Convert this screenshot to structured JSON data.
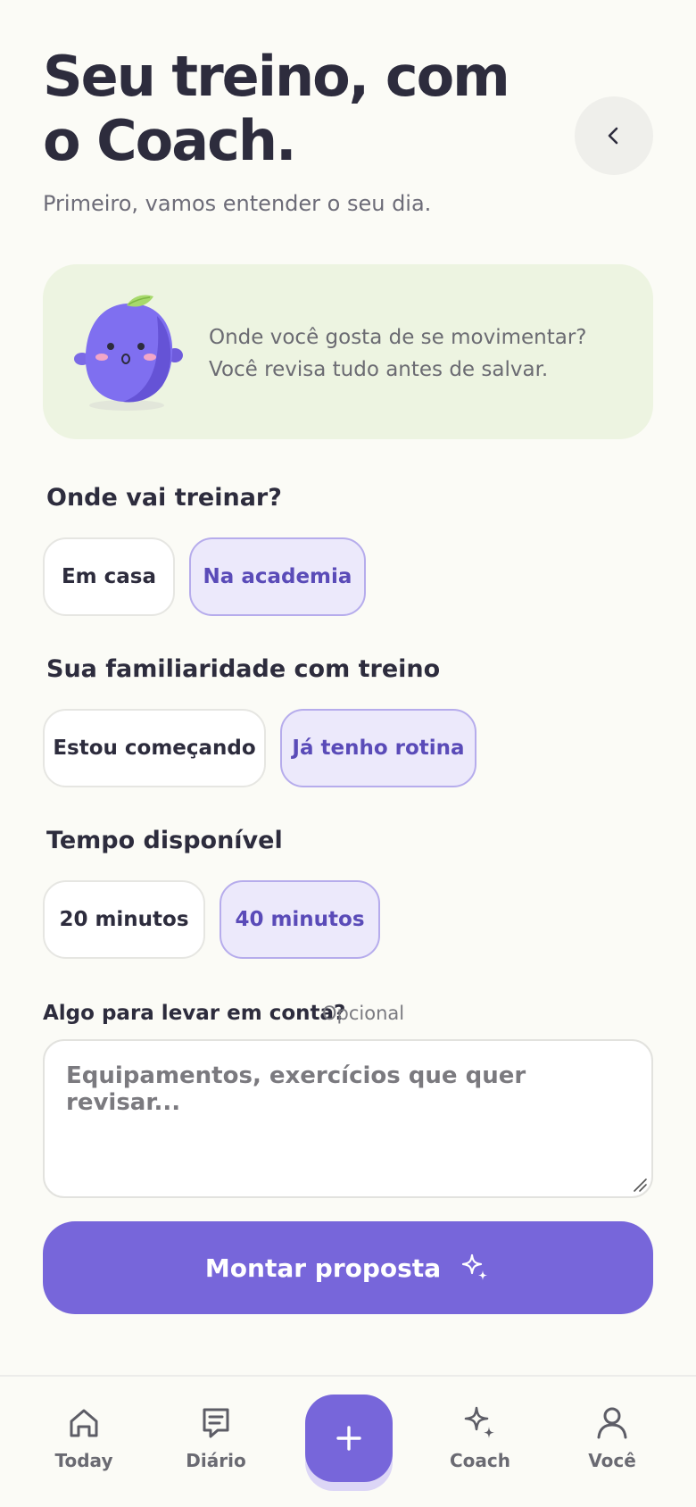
{
  "header": {
    "title": "Seu treino, com o Coach.",
    "subtitle": "Primeiro, vamos entender o seu dia.",
    "back_icon": "chevron-left-icon"
  },
  "coach_card": {
    "line1": "Onde você gosta de se movimentar?",
    "line2": "Você revisa tudo antes de salvar.",
    "mascot": "plum-mascot"
  },
  "where": {
    "label": "Onde vai treinar?",
    "options": [
      "Em casa",
      "Na academia"
    ],
    "selected": "Na academia"
  },
  "familiarity": {
    "label": "Sua familiaridade com treino",
    "options": [
      "Estou começando",
      "Já tenho rotina"
    ],
    "selected": "Já tenho rotina"
  },
  "time": {
    "label": "Tempo disponível",
    "options": [
      "20 minutos",
      "40 minutos"
    ],
    "selected": "40 minutos"
  },
  "notes": {
    "label": "Algo para levar em conta?",
    "optional": "Opcional",
    "placeholder": "Equipamentos, exercícios que quer revisar...",
    "value": ""
  },
  "cta": {
    "label": "Montar proposta",
    "icon": "sparkles-icon"
  },
  "tabbar": {
    "items": [
      {
        "label": "Today",
        "icon": "home-icon"
      },
      {
        "label": "Diário",
        "icon": "journal-icon"
      },
      {
        "label": "",
        "icon": "plus-icon"
      },
      {
        "label": "Coach",
        "icon": "sparkles-icon"
      },
      {
        "label": "Você",
        "icon": "user-icon"
      }
    ]
  },
  "colors": {
    "accent": "#7766da",
    "selected_chip_bg": "#ece9fb",
    "selected_chip_border": "#b6acec",
    "card_bg": "#edf4e1",
    "page_bg": "#fbfbf6"
  }
}
